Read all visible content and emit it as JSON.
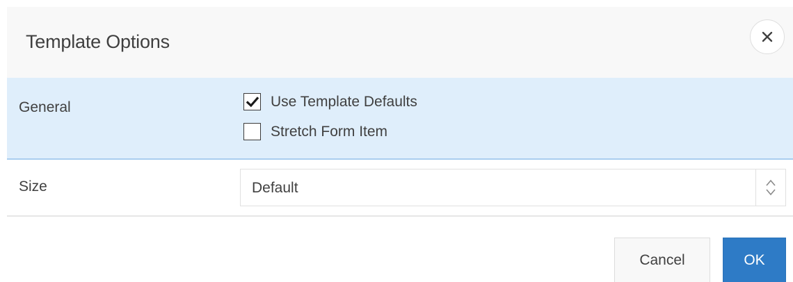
{
  "dialog": {
    "title": "Template Options",
    "close_icon": "close-icon"
  },
  "general": {
    "label": "General",
    "options": [
      {
        "label": "Use Template Defaults",
        "checked": true
      },
      {
        "label": "Stretch Form Item",
        "checked": false
      }
    ]
  },
  "size": {
    "label": "Size",
    "selected": "Default",
    "arrow_icon": "chevron-up-down-icon"
  },
  "footer": {
    "cancel_label": "Cancel",
    "ok_label": "OK"
  },
  "colors": {
    "header_bg": "#f8f8f8",
    "general_bg": "#dfeefb",
    "general_border": "#a9cdef",
    "primary": "#2e7bc6"
  }
}
